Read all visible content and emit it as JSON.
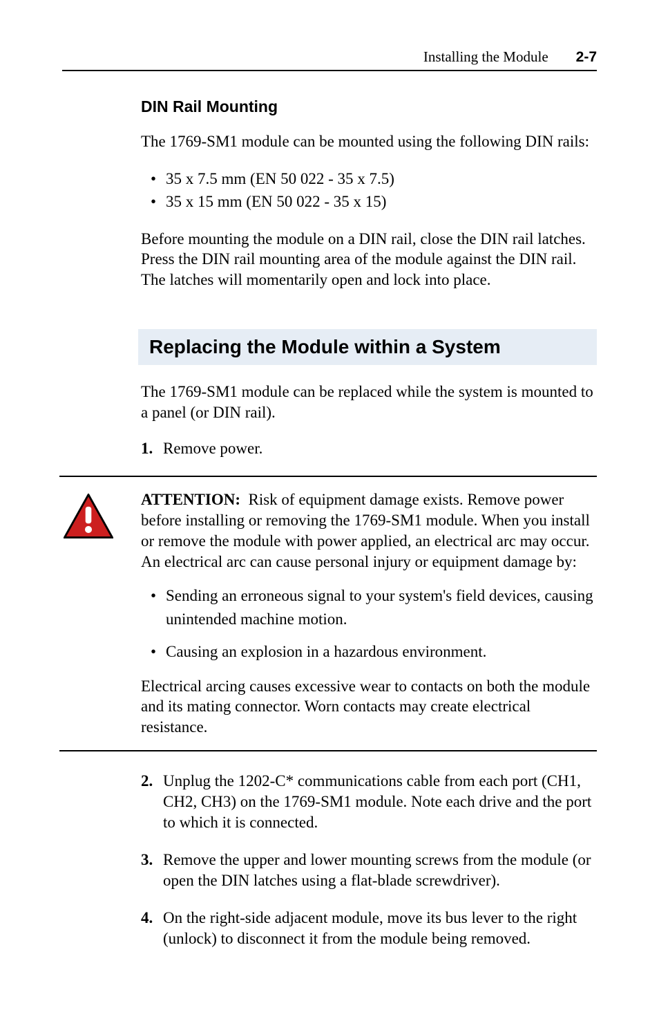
{
  "header": {
    "title": "Installing the Module",
    "page": "2-7"
  },
  "section_din": {
    "heading": "DIN Rail Mounting",
    "intro": "The 1769-SM1 module can be mounted using the following DIN rails:",
    "bullets": [
      "35 x 7.5 mm (EN 50 022 - 35 x 7.5)",
      "35 x 15 mm (EN 50 022 - 35 x 15)"
    ],
    "para": "Before mounting the module on a DIN rail, close the DIN rail latches. Press the DIN rail mounting area of the module against the DIN rail. The latches will momentarily open and lock into place."
  },
  "section_replace": {
    "heading": "Replacing the Module within a System",
    "intro": "The 1769-SM1 module can be replaced while the system is mounted to a panel (or DIN rail).",
    "steps": {
      "s1": {
        "num": "1.",
        "text": "Remove power."
      },
      "s2": {
        "num": "2.",
        "text": "Unplug the 1202-C* communications cable from each port (CH1, CH2, CH3) on the 1769-SM1 module. Note each drive and the port to which it is connected."
      },
      "s3": {
        "num": "3.",
        "text": "Remove the upper and lower mounting screws from the module (or open the DIN latches using a flat-blade screwdriver)."
      },
      "s4": {
        "num": "4.",
        "text": "On the right-side adjacent module, move its bus lever to the right (unlock) to disconnect it from the module being removed."
      }
    }
  },
  "attention": {
    "label": "ATTENTION:",
    "lead": "Risk of equipment damage exists. Remove power before installing or removing the 1769-SM1 module. When you install or remove the module with power applied, an electrical arc may occur. An electrical arc can cause personal injury or equipment damage by:",
    "bullets": [
      "Sending an erroneous signal to your system's field devices, causing unintended machine motion.",
      "Causing an explosion in a hazardous environment."
    ],
    "trail": "Electrical arcing causes excessive wear to contacts on both the module and its mating connector. Worn contacts may create electrical resistance."
  },
  "icons": {
    "attention": "attention-triangle-icon"
  }
}
